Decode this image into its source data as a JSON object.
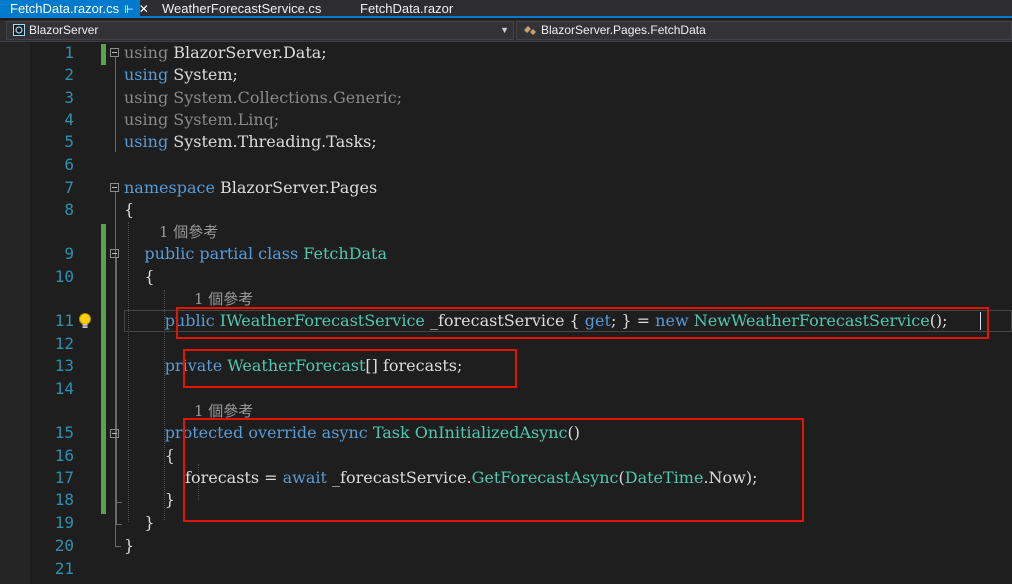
{
  "tabs": [
    {
      "label": "FetchData.razor.cs",
      "active": true,
      "pin_icon": "pin-icon",
      "close_icon": "close-icon"
    },
    {
      "label": "WeatherForecastService.cs",
      "active": false
    },
    {
      "label": "FetchData.razor",
      "active": false
    }
  ],
  "navbar": {
    "project": "BlazorServer",
    "type": "BlazorServer.Pages.FetchData"
  },
  "editor": {
    "line_numbers": [
      "1",
      "2",
      "3",
      "4",
      "5",
      "6",
      "7",
      "8",
      "9",
      "10",
      "11",
      "12",
      "13",
      "14",
      "15",
      "16",
      "17",
      "18",
      "19",
      "20",
      "21"
    ],
    "reference_hint": "1 個參考",
    "lightbulb_line": "11"
  },
  "colors": {
    "accent": "#007acc",
    "keyword": "#569cd6",
    "type": "#4ec9b0",
    "line_number": "#2b91af",
    "highlight_box": "#e51400",
    "change_bar": "#57a64a"
  }
}
